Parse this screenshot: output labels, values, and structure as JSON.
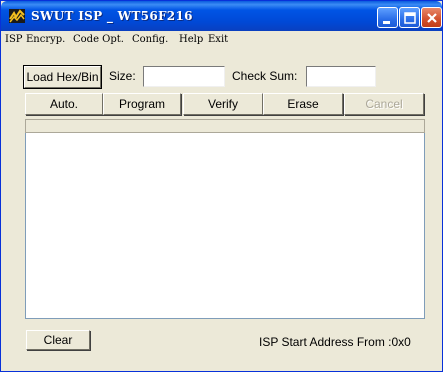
{
  "window": {
    "title": "SWUT ISP _ WT56F216",
    "icon": "lightning-app-icon",
    "controls": {
      "minimize": "minimize-icon",
      "maximize": "maximize-icon",
      "close": "close-icon"
    }
  },
  "menu": {
    "items": [
      {
        "label": "ISP"
      },
      {
        "label": "Encryp."
      },
      {
        "label": "Code Opt."
      },
      {
        "label": "Config."
      },
      {
        "label": "Help"
      },
      {
        "label": "Exit"
      }
    ]
  },
  "toolbar": {
    "load_label": "Load Hex/Bin",
    "size_label": "Size:",
    "size_value": "",
    "checksum_label": "Check Sum:",
    "checksum_value": ""
  },
  "actions": {
    "auto": "Auto.",
    "program": "Program",
    "verify": "Verify",
    "erase": "Erase",
    "cancel": "Cancel"
  },
  "log": {
    "content": ""
  },
  "footer": {
    "clear": "Clear",
    "status": "ISP Start Address From :0x0"
  },
  "colors": {
    "titlebar": "#0055e5",
    "window_bg": "#ece9d8",
    "close_button": "#d2502c"
  }
}
